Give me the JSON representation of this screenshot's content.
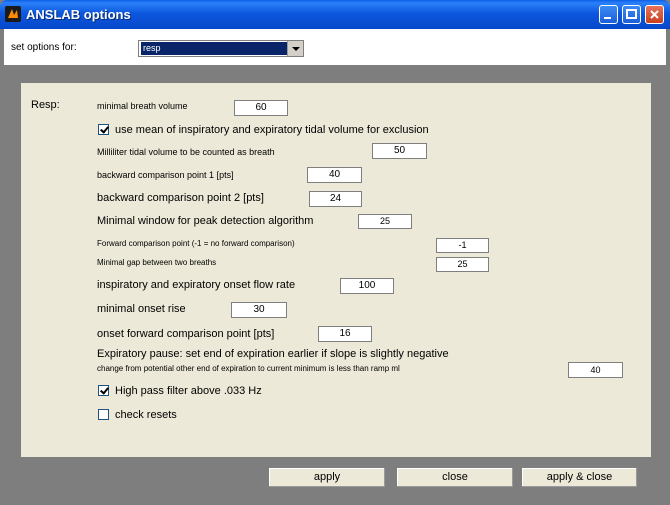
{
  "window": {
    "title": "ANSLAB options"
  },
  "header": {
    "set_options_label": "set options for:",
    "selected": "resp"
  },
  "section": {
    "label": "Resp:"
  },
  "fields": {
    "min_breath_volume": {
      "label": "minimal breath volume",
      "value": "60"
    },
    "use_mean_checkbox": {
      "label": "use mean of inspiratory and expiratory tidal volume for exclusion",
      "checked": true
    },
    "ml_tidal_volume": {
      "label": "Milliliter tidal volume to be counted as breath",
      "value": "50"
    },
    "backward_point_1": {
      "label": "backward comparison point 1 [pts]",
      "value": "40"
    },
    "backward_point_2": {
      "label": "backward comparison point 2 [pts]",
      "value": "24"
    },
    "min_window": {
      "label": "Minimal window for peak detection algorithm",
      "value": "25"
    },
    "forward_point": {
      "label": "Forward comparison point (-1 = no forward comparison)",
      "value": "-1"
    },
    "min_gap": {
      "label": "Minimal gap between two breaths",
      "value": "25"
    },
    "onset_flow_rate": {
      "label": "inspiratory and expiratory onset flow rate",
      "value": "100"
    },
    "min_onset_rise": {
      "label": "minimal onset rise",
      "value": "30"
    },
    "onset_forward": {
      "label": "onset forward comparison point [pts]",
      "value": "16"
    },
    "expiratory_pause": {
      "label": "Expiratory pause: set end of expiration earlier if slope is slightly negative"
    },
    "change_from_potential": {
      "label": "change from potential other end  of expiration to current minimum is less than ramp ml",
      "value": "40"
    },
    "high_pass_checkbox": {
      "label": "High pass filter above .033 Hz",
      "checked": true
    },
    "check_resets_checkbox": {
      "label": "check resets",
      "checked": false
    }
  },
  "buttons": {
    "apply": "apply",
    "close": "close",
    "apply_close": "apply & close"
  }
}
